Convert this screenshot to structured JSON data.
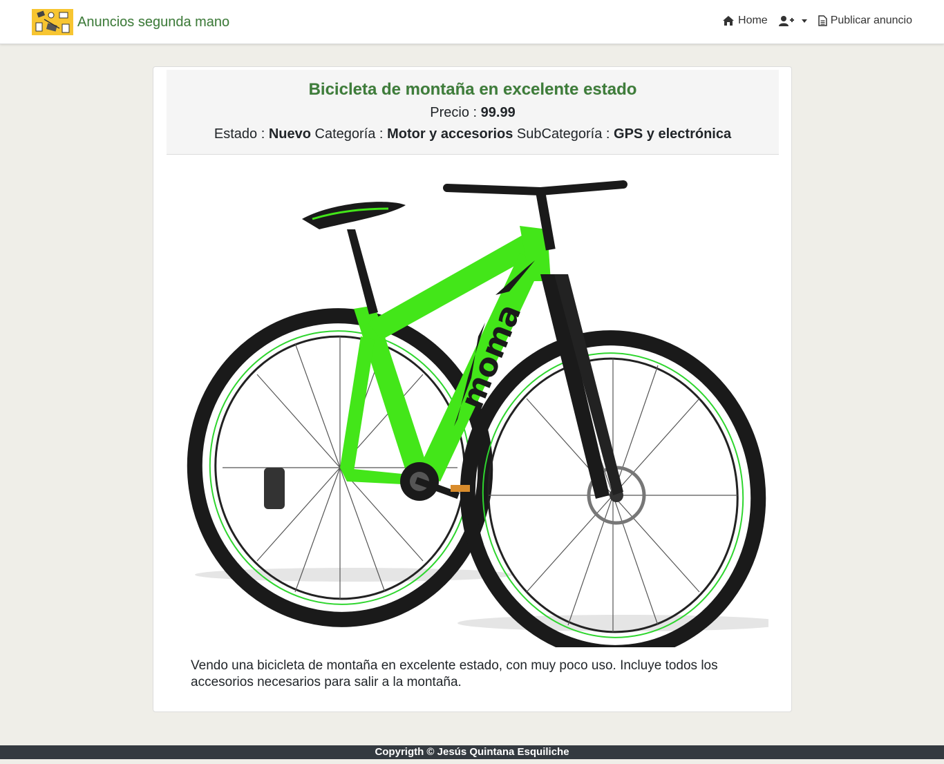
{
  "navbar": {
    "brand_name": "Anuncios segunda mano",
    "links": {
      "home_label": "Home",
      "publish_label": "Publicar anuncio"
    },
    "icons": [
      "house-icon",
      "user-plus-icon",
      "file-icon"
    ]
  },
  "listing": {
    "title": "Bicicleta de montaña en excelente estado",
    "price_label": "Precio :",
    "price_value": "99.99",
    "state_label": "Estado :",
    "state_value": "Nuevo",
    "category_label": "Categoría :",
    "category_value": "Motor y accesorios",
    "subcategory_label": "SubCategoría :",
    "subcategory_value": "GPS y electrónica",
    "description": "Vendo una bicicleta de montaña en excelente estado, con muy poco uso. Incluye todos los accesorios necesarios para salir a la montaña.",
    "image_brand_text": "moma"
  },
  "footer": {
    "text": "Copyrigth © Jesús Quintana Esquiliche"
  },
  "colors": {
    "brand_green": "#3e7d3a",
    "logo_yellow": "#f7c531",
    "page_bg": "#efeee8",
    "footer_bg": "#343a40",
    "bike_green": "#43e619"
  }
}
